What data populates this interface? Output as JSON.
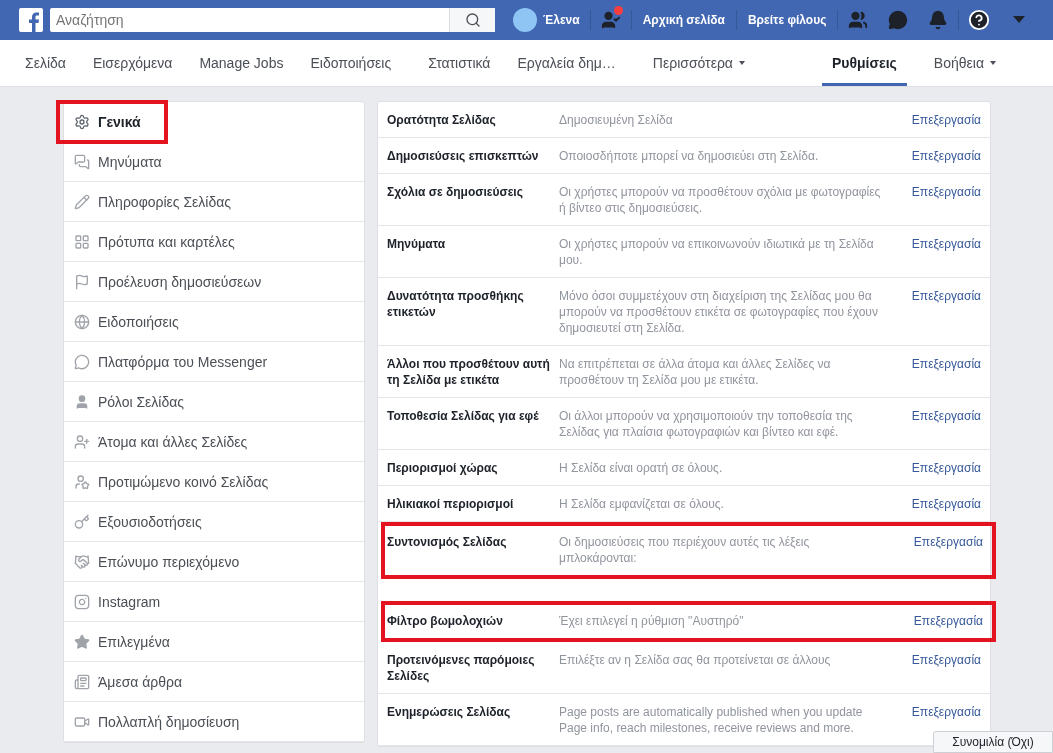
{
  "topbar": {
    "search": {
      "placeholder": "Αναζήτηση"
    },
    "user": "Έλενα",
    "friend_requests_badge": true,
    "links": [
      "Αρχική σελίδα",
      "Βρείτε φίλους"
    ]
  },
  "tabs": [
    {
      "label": "Σελίδα",
      "selected": false
    },
    {
      "label": "Εισερχόμενα",
      "selected": false
    },
    {
      "label": "Manage Jobs",
      "selected": false
    },
    {
      "label": "Ειδοποιήσεις",
      "selected": false
    },
    {
      "label": "Στατιστικά",
      "selected": false
    },
    {
      "label": "Εργαλεία δημ…",
      "selected": false
    },
    {
      "label": "Περισσότερα",
      "selected": false,
      "dropdown": true
    },
    {
      "label": "Ρυθμίσεις",
      "selected": true
    },
    {
      "label": "Βοήθεια",
      "selected": false,
      "dropdown": true
    }
  ],
  "sidebar": {
    "items": [
      {
        "label": "Γενικά",
        "selected": true,
        "highlighted": true
      },
      {
        "label": "Μηνύματα",
        "selected": false,
        "highlighted": false
      },
      {
        "label": "Πληροφορίες Σελίδας",
        "selected": false,
        "highlighted": false
      },
      {
        "label": "Πρότυπα και καρτέλες",
        "selected": false,
        "highlighted": false
      },
      {
        "label": "Προέλευση δημοσιεύσεων",
        "selected": false,
        "highlighted": false
      },
      {
        "label": "Ειδοποιήσεις",
        "selected": false,
        "highlighted": false
      },
      {
        "label": "Πλατφόρμα του Messenger",
        "selected": false,
        "highlighted": false
      },
      {
        "label": "Ρόλοι Σελίδας",
        "selected": false,
        "highlighted": false
      },
      {
        "label": "Άτομα και άλλες Σελίδες",
        "selected": false,
        "highlighted": false
      },
      {
        "label": "Προτιμώμενο κοινό Σελίδας",
        "selected": false,
        "highlighted": false
      },
      {
        "label": "Εξουσιοδοτήσεις",
        "selected": false,
        "highlighted": false
      },
      {
        "label": "Επώνυμο περιεχόμενο",
        "selected": false,
        "highlighted": false
      },
      {
        "label": "Instagram",
        "selected": false,
        "highlighted": false
      },
      {
        "label": "Επιλεγμένα",
        "selected": false,
        "highlighted": false
      },
      {
        "label": "Άμεσα άρθρα",
        "selected": false,
        "highlighted": false
      },
      {
        "label": "Πολλαπλή δημοσίευση",
        "selected": false,
        "highlighted": false
      }
    ]
  },
  "settings": [
    {
      "name": "Ορατότητα Σελίδας",
      "value": "Δημοσιευμένη Σελίδα",
      "action": "Επεξεργασία",
      "highlighted": false
    },
    {
      "name": "Δημοσιεύσεις επισκεπτών",
      "value": "Οποιοσδήποτε μπορεί να δημοσιεύει στη Σελίδα.",
      "action": "Επεξεργασία",
      "highlighted": false
    },
    {
      "name": "Σχόλια σε δημοσιεύσεις",
      "value": "Οι χρήστες μπορούν να προσθέτουν σχόλια με φωτογραφίες ή βίντεο στις δημοσιεύσεις.",
      "action": "Επεξεργασία",
      "highlighted": false
    },
    {
      "name": "Μηνύματα",
      "value": "Οι χρήστες μπορούν να επικοινωνούν ιδιωτικά με τη Σελίδα μου.",
      "action": "Επεξεργασία",
      "highlighted": false
    },
    {
      "name": "Δυνατότητα προσθήκης ετικετών",
      "value": "Μόνο όσοι συμμετέχουν στη διαχείριση της Σελίδας μου θα μπορούν να προσθέτουν ετικέτα σε φωτογραφίες που έχουν δημοσιευτεί στη Σελίδα.",
      "action": "Επεξεργασία",
      "highlighted": false
    },
    {
      "name": "Άλλοι που προσθέτουν αυτή τη Σελίδα με ετικέτα",
      "value": "Να επιτρέπεται σε άλλα άτομα και άλλες Σελίδες να προσθέτουν τη Σελίδα μου με ετικέτα.",
      "action": "Επεξεργασία",
      "highlighted": false
    },
    {
      "name": "Τοποθεσία Σελίδας για εφέ",
      "value": "Οι άλλοι μπορούν να χρησιμοποιούν την τοποθεσία της Σελίδας για πλαίσια φωτογραφιών και βίντεο και εφέ.",
      "action": "Επεξεργασία",
      "highlighted": false
    },
    {
      "name": "Περιορισμοί χώρας",
      "value": "Η Σελίδα είναι ορατή σε όλους.",
      "action": "Επεξεργασία",
      "highlighted": false
    },
    {
      "name": "Ηλικιακοί περιορισμοί",
      "value": "Η Σελίδα εμφανίζεται σε όλους.",
      "action": "Επεξεργασία",
      "highlighted": false
    },
    {
      "name": "Συντονισμός Σελίδας",
      "value": "Οι δημοσιεύσεις που περιέχουν αυτές τις λέξεις μπλοκάρονται:",
      "action": "Επεξεργασία",
      "highlighted": true
    },
    {
      "name": "Φίλτρο βωμολοχιών",
      "value": "Έχει επιλεγεί η ρύθμιση \"Αυστηρό\"",
      "action": "Επεξεργασία",
      "highlighted": true
    },
    {
      "name": "Προτεινόμενες παρόμοιες Σελίδες",
      "value": "Επιλέξτε αν η Σελίδα σας θα προτείνεται σε άλλους",
      "action": "Επεξεργασία",
      "highlighted": false
    },
    {
      "name": "Ενημερώσεις Σελίδας",
      "value": "Page posts are automatically published when you update Page info, reach milestones, receive reviews and more.",
      "action": "Επεξεργασία",
      "highlighted": false
    }
  ],
  "chat_bar": "Συνομιλία (Όχι)"
}
